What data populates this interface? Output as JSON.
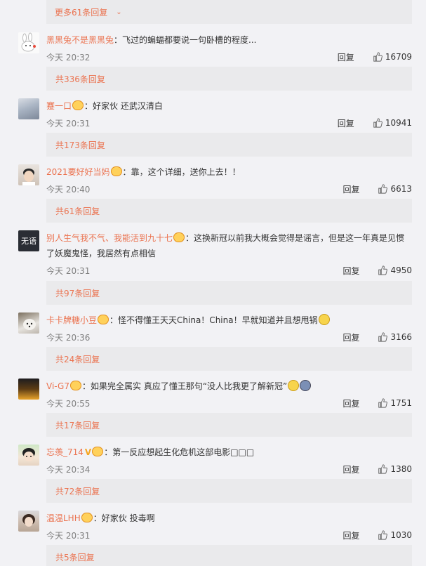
{
  "top_more": {
    "label": "更多61条回复"
  },
  "comments": [
    {
      "user": "黑黑兔不是黑黑兔",
      "separator": "：",
      "text": "飞过的蝙蝠都要说一句卧槽的程度...",
      "time": "今天 20:32",
      "reply_label": "回复",
      "likes": "16709",
      "sub_replies": "共336条回复"
    },
    {
      "user": "蹇一口",
      "separator": "：",
      "text": "好家伙 还武汉清白",
      "time": "今天 20:31",
      "reply_label": "回复",
      "likes": "10941",
      "sub_replies": "共173条回复"
    },
    {
      "user": "2021要好好当妈",
      "separator": "：",
      "text": "靠，这个详细，送你上去！！",
      "time": "今天 20:40",
      "reply_label": "回复",
      "likes": "6613",
      "sub_replies": "共61条回复"
    },
    {
      "user": "别人生气我不气、我能活到九十七",
      "separator": "：",
      "text": "这换新冠以前我大概会觉得是谣言，但是这一年真是见惯了妖魔鬼怪，我居然有点相信",
      "time": "今天 20:31",
      "reply_label": "回复",
      "likes": "4950",
      "sub_replies": "共97条回复",
      "avatar_text": "无语"
    },
    {
      "user": "卡卡牌糖小豆",
      "separator": "：",
      "text": "怪不得懂王天天China！China！早就知道并且想甩锅",
      "time": "今天 20:36",
      "reply_label": "回复",
      "likes": "3166",
      "sub_replies": "共24条回复"
    },
    {
      "user": "Vi-G7",
      "separator": "：",
      "text": "如果完全属实 真应了懂王那句“没人比我更了解新冠”",
      "time": "今天 20:55",
      "reply_label": "回复",
      "likes": "1751",
      "sub_replies": "共17条回复"
    },
    {
      "user": "忘羡_714",
      "separator": "：",
      "text": "第一反应想起生化危机这部电影□□□",
      "time": "今天 20:34",
      "reply_label": "回复",
      "likes": "1380",
      "sub_replies": "共72条回复"
    },
    {
      "user": "温温LHH",
      "separator": "：",
      "text": "好家伙 投毒啊",
      "time": "今天 20:31",
      "reply_label": "回复",
      "likes": "1030",
      "sub_replies": "共5条回复"
    }
  ],
  "colors": {
    "accent": "#eb7350",
    "bar_bg": "#eaeaec",
    "page_bg": "#f2f2f5"
  }
}
